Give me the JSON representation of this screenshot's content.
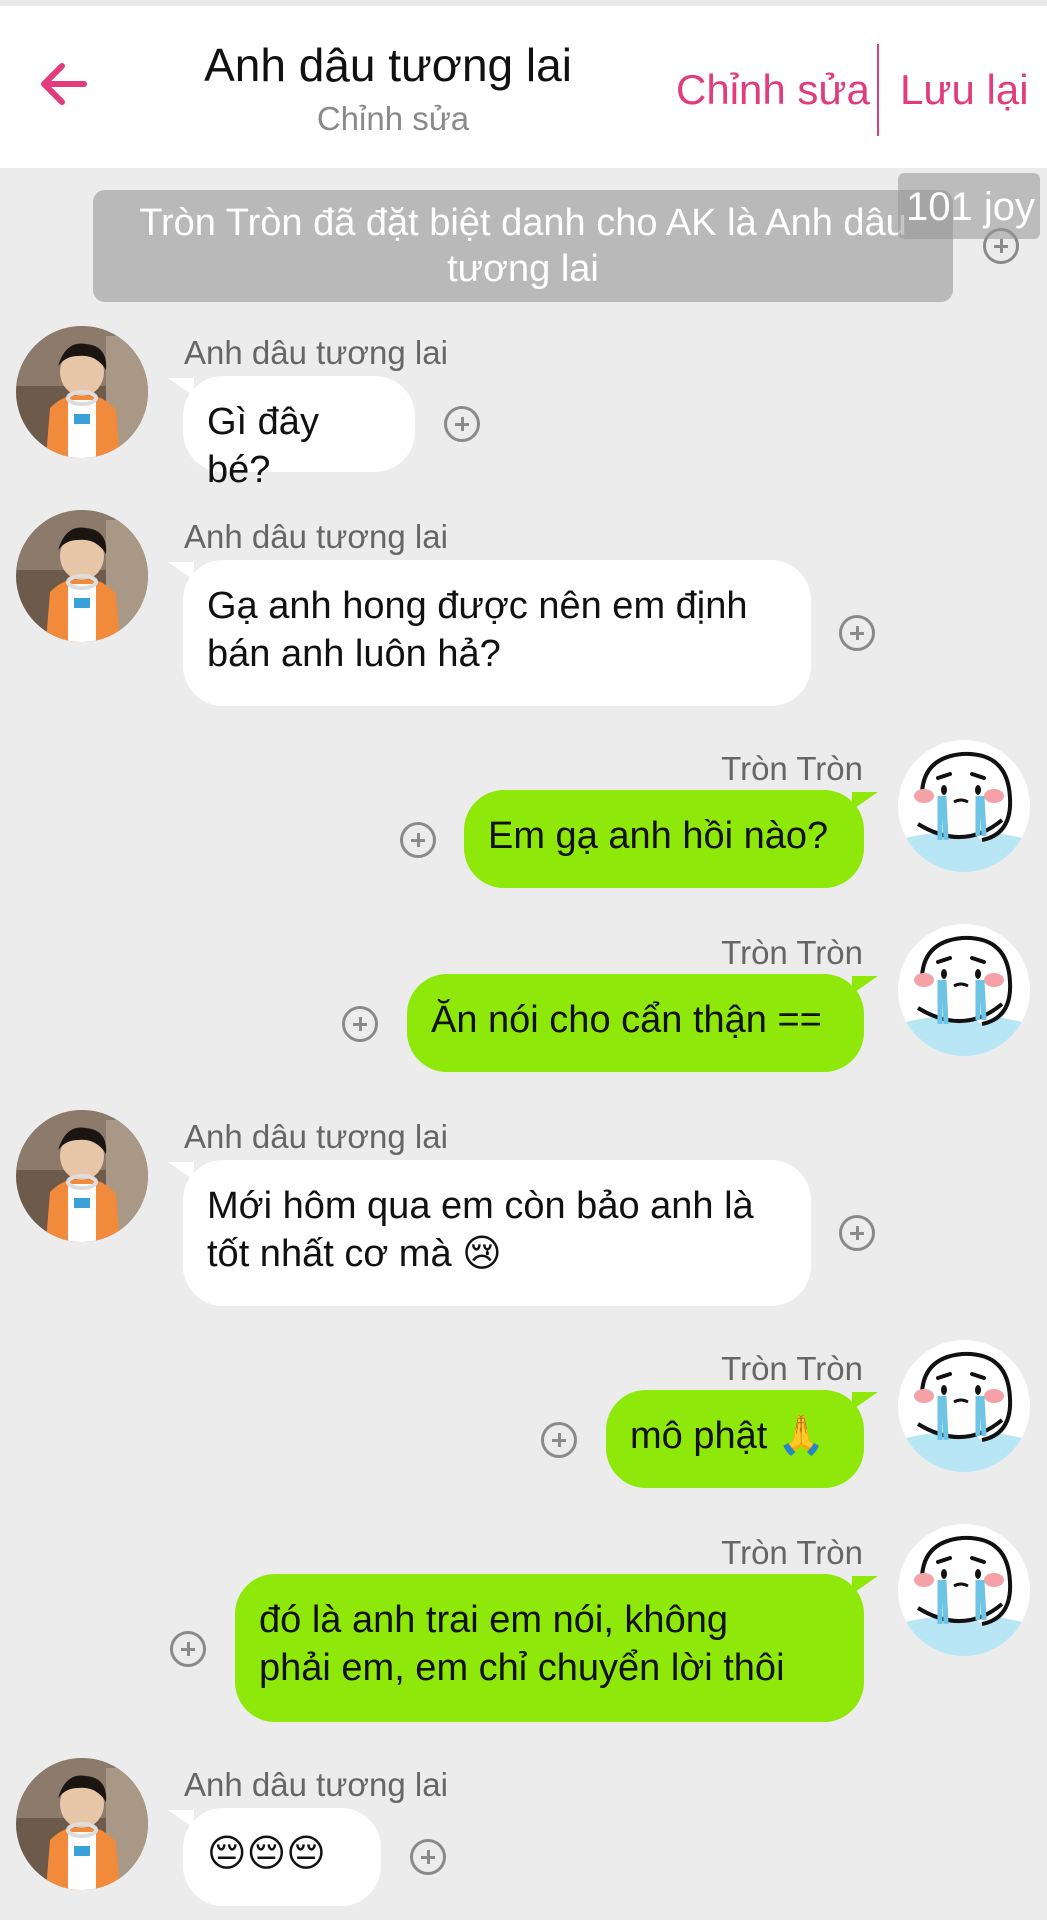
{
  "header": {
    "title": "Anh dâu tương lai",
    "subtitle": "Chỉnh sửa",
    "edit_label": "Chỉnh sửa",
    "save_label": "Lưu lại",
    "back_icon": "arrow-left-icon",
    "accent_color": "#e23c7c"
  },
  "notice": {
    "line1": "Tròn Tròn đã đặt biệt danh cho AK là Anh dâu",
    "line2": "tương lai"
  },
  "watermark": "101 joy",
  "messages": [
    {
      "side": "in",
      "sender": "Anh dâu tương lai",
      "lines": [
        "Gì đây bé?"
      ]
    },
    {
      "side": "in",
      "sender": "Anh dâu tương lai",
      "lines": [
        "Gạ anh hong được nên em định",
        "bán anh luôn hả?"
      ]
    },
    {
      "side": "out",
      "sender": "Tròn Tròn",
      "lines": [
        "Em gạ anh hồi nào?"
      ]
    },
    {
      "side": "out",
      "sender": "Tròn Tròn",
      "lines": [
        "Ăn nói cho cẩn thận =="
      ]
    },
    {
      "side": "in",
      "sender": "Anh dâu tương lai",
      "lines": [
        "Mới hôm qua em còn bảo anh là",
        "tốt nhất cơ mà 😢"
      ]
    },
    {
      "side": "out",
      "sender": "Tròn Tròn",
      "lines": [
        "mô phật 🙏"
      ]
    },
    {
      "side": "out",
      "sender": "Tròn Tròn",
      "lines": [
        "đó là anh trai em nói, không",
        "phải em, em chỉ chuyển lời thôi"
      ]
    },
    {
      "side": "in",
      "sender": "Anh dâu tương lai",
      "lines": [
        "😔😔😔"
      ]
    }
  ],
  "colors": {
    "incoming_bubble": "#ffffff",
    "outgoing_bubble": "#8ee80a",
    "background": "#ececec"
  }
}
